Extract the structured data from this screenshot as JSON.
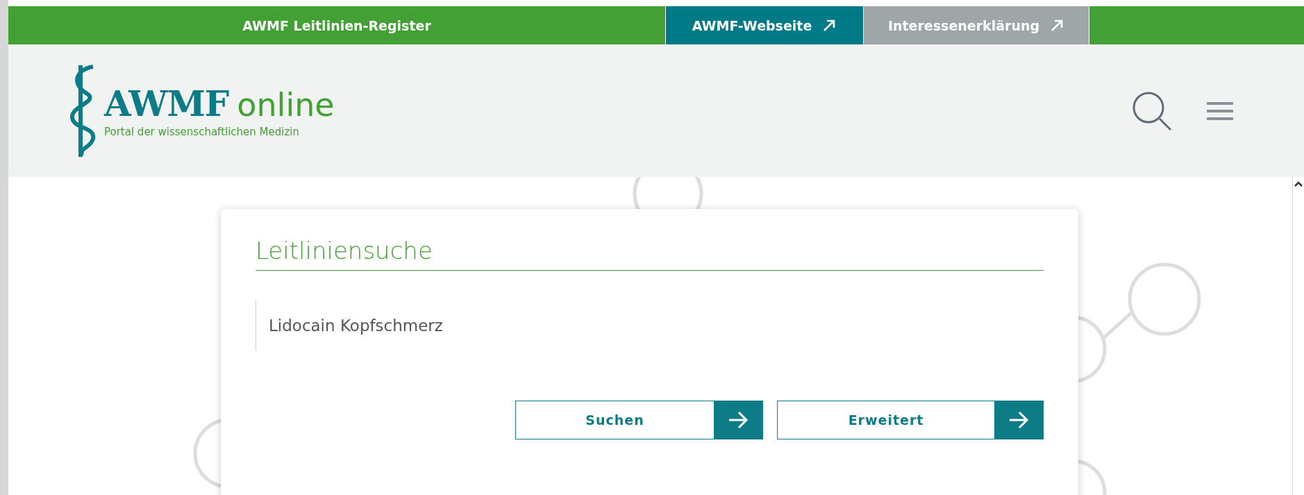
{
  "top_bar": {
    "title": "AWMF Leitlinien-Register",
    "links": [
      {
        "label": "AWMF-Webseite",
        "kind": "primary"
      },
      {
        "label": "Interessenerklärung",
        "kind": "secondary"
      }
    ]
  },
  "logo": {
    "name": "AWMF",
    "suffix": "online",
    "tagline": "Portal der wissenschaftlichen Medizin"
  },
  "search_panel": {
    "title": "Leitliniensuche",
    "query": "Lidocain Kopfschmerz",
    "buttons": [
      "Suchen",
      "Erweitert"
    ]
  }
}
